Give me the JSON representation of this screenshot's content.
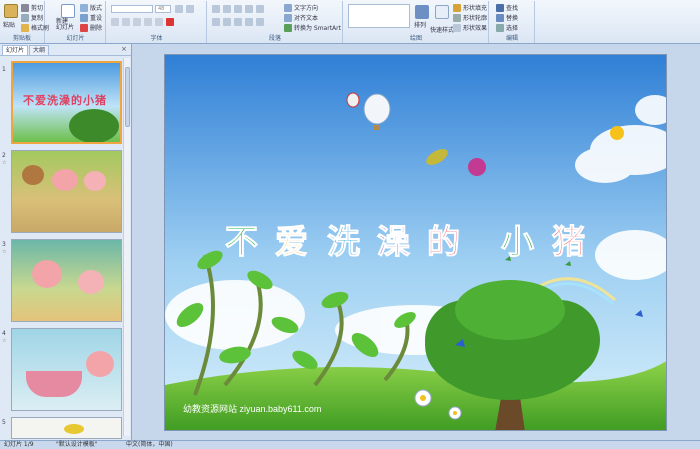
{
  "ribbon": {
    "clipboard": {
      "paste": "粘贴",
      "cut": "剪切",
      "copy": "复制",
      "format_painter": "格式刷",
      "label": "剪贴板"
    },
    "slides": {
      "new_slide": "新建\n幻灯片",
      "layout": "版式",
      "reset": "重设",
      "delete": "删除",
      "label": "幻灯片"
    },
    "font": {
      "size": "48",
      "label": "字体"
    },
    "paragraph": {
      "text_direction": "文字方向",
      "align_text": "对齐文本",
      "smartart": "转换为 SmartArt",
      "label": "段落"
    },
    "drawing": {
      "arrange": "排列",
      "quick_styles": "快速样式",
      "shape_fill": "形状填充",
      "shape_outline": "形状轮廓",
      "shape_effects": "形状效果",
      "label": "绘图"
    },
    "editing": {
      "find": "查找",
      "replace": "替换",
      "select": "选择",
      "label": "编辑"
    }
  },
  "panel": {
    "tabs": [
      "幻灯片",
      "大纲"
    ],
    "close": "×",
    "slides": [
      {
        "num": "1",
        "star": ""
      },
      {
        "num": "2",
        "star": "☆"
      },
      {
        "num": "3",
        "star": "☆"
      },
      {
        "num": "4",
        "star": "☆"
      },
      {
        "num": "5",
        "star": ""
      }
    ]
  },
  "slide": {
    "title_chars": [
      "不",
      "爱",
      "洗",
      "澡",
      "的",
      "小",
      "猪"
    ],
    "title_colors": [
      "#22b14c",
      "#f0b020",
      "#1a9ad6",
      "#7a3fc0",
      "#e0193c",
      "#32a852",
      "#e4202a"
    ],
    "footer": "幼教资源网站 ziyuan.baby611.com",
    "thumb1_title": "不爱洗澡的小猪"
  },
  "status": {
    "slide_info": "幻灯片 1/9",
    "theme": "\"默认设计模板\"",
    "language": "中文(简体，中国)"
  }
}
